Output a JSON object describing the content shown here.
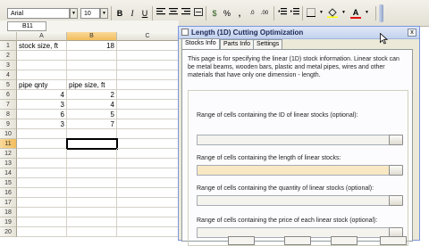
{
  "toolbar": {
    "font_name": "Arial",
    "font_size": "10",
    "bold": "B",
    "italic": "I",
    "underline": "U",
    "currency": "$",
    "percent": "%",
    "comma": ",",
    "font_color_letter": "A"
  },
  "namebox": "B11",
  "columns": [
    "A",
    "B",
    "C"
  ],
  "rows": [
    {
      "n": "1",
      "a": "stock size, ft",
      "b": "18"
    },
    {
      "n": "2",
      "a": "",
      "b": ""
    },
    {
      "n": "3",
      "a": "",
      "b": ""
    },
    {
      "n": "4",
      "a": "",
      "b": ""
    },
    {
      "n": "5",
      "a": "pipe qnty",
      "b": "pipe size, ft"
    },
    {
      "n": "6",
      "a": "4",
      "b": "2"
    },
    {
      "n": "7",
      "a": "3",
      "b": "4"
    },
    {
      "n": "8",
      "a": "6",
      "b": "5"
    },
    {
      "n": "9",
      "a": "3",
      "b": "7"
    },
    {
      "n": "10",
      "a": "",
      "b": ""
    },
    {
      "n": "11",
      "a": "",
      "b": ""
    },
    {
      "n": "12",
      "a": "",
      "b": ""
    },
    {
      "n": "13",
      "a": "",
      "b": ""
    },
    {
      "n": "14",
      "a": "",
      "b": ""
    },
    {
      "n": "15",
      "a": "",
      "b": ""
    },
    {
      "n": "16",
      "a": "",
      "b": ""
    },
    {
      "n": "17",
      "a": "",
      "b": ""
    },
    {
      "n": "18",
      "a": "",
      "b": ""
    },
    {
      "n": "19",
      "a": "",
      "b": ""
    },
    {
      "n": "20",
      "a": "",
      "b": ""
    }
  ],
  "dialog": {
    "title": "Length (1D) Cutting Optimization",
    "close": "x",
    "tabs": [
      "Stocks Info",
      "Parts Info",
      "Settings"
    ],
    "description": "This page is for specifying the linear (1D) stock information. Linear stock can be metal beams, wooden bars, plastic and metal pipes, wires and other materials that have only one dimension - length.",
    "fields": [
      "Range of cells containing the ID of linear stocks (optional):",
      "Range of cells containing the length of linear stocks:",
      "Range of cells containing the quantity of linear stocks (optional):",
      "Range of cells containing the price of each linear stock (optional):"
    ]
  },
  "colors": {
    "selection_header": "#f2bd5c",
    "highlight_field": "#f9e8c4",
    "dialog_bg": "#ece9d8"
  }
}
